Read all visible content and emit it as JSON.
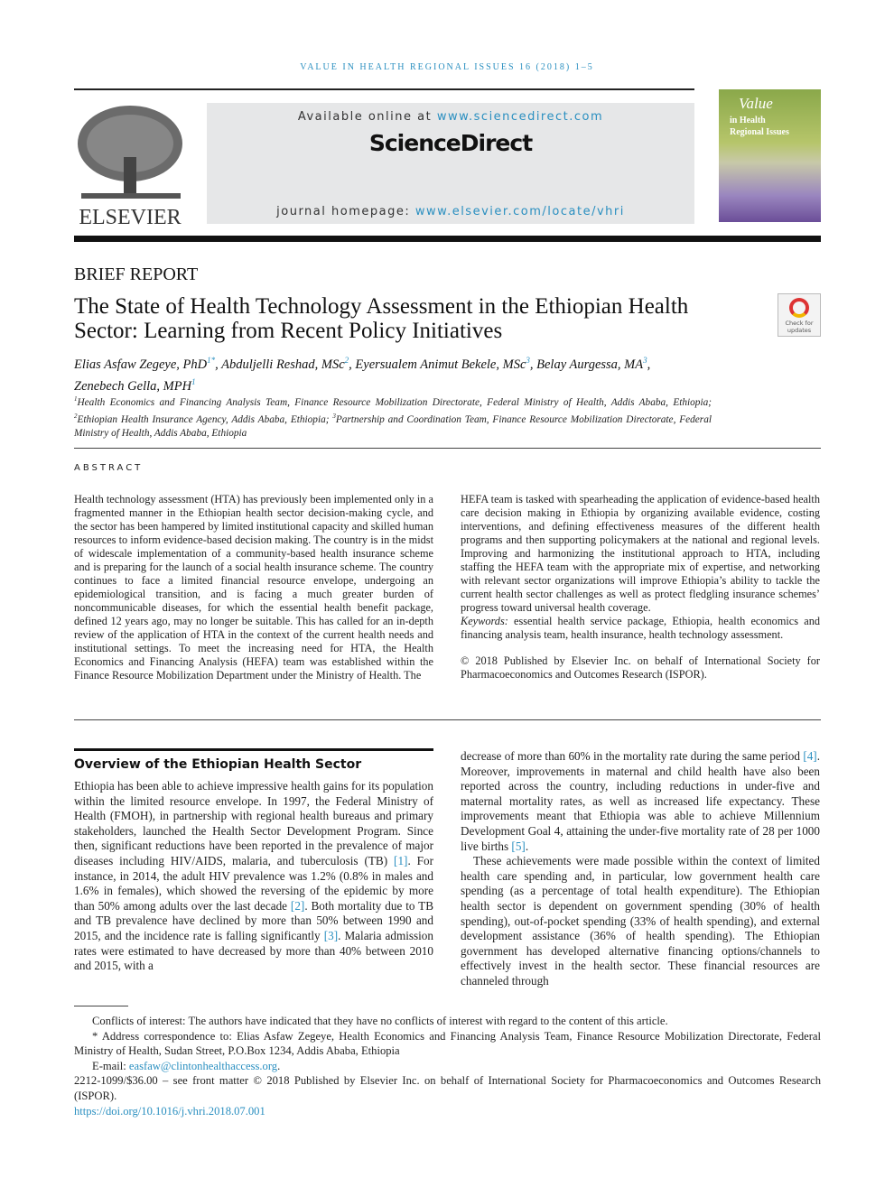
{
  "running_head": "VALUE IN HEALTH REGIONAL ISSUES 16 (2018) 1–5",
  "publisher_logo": "ELSEVIER",
  "banner": {
    "available_prefix": "Available online at ",
    "available_url": "www.sciencedirect.com",
    "brand": "ScienceDirect",
    "homepage_prefix": "journal homepage: ",
    "homepage_url": "www.elsevier.com/locate/vhri"
  },
  "cover": {
    "line1": "Value",
    "line2": "in Health",
    "line3": "Regional Issues"
  },
  "article_type": "BRIEF REPORT",
  "title": "The State of Health Technology Assessment in the Ethiopian Health Sector: Learning from Recent Policy Initiatives",
  "check_updates": "Check for updates",
  "authors": [
    {
      "name": "Elias Asfaw Zegeye, PhD",
      "sup": "1*"
    },
    {
      "name": "Abduljelli Reshad, MSc",
      "sup": "2"
    },
    {
      "name": "Eyersualem Animut Bekele, MSc",
      "sup": "3"
    },
    {
      "name": "Belay Aurgessa, MA",
      "sup": "3"
    },
    {
      "name": "Zenebech Gella, MPH",
      "sup": "1"
    }
  ],
  "affiliations": [
    {
      "sup": "1",
      "text": "Health Economics and Financing Analysis Team, Finance Resource Mobilization Directorate, Federal Ministry of Health, Addis Ababa, Ethiopia; "
    },
    {
      "sup": "2",
      "text": "Ethiopian Health Insurance Agency, Addis Ababa, Ethiopia; "
    },
    {
      "sup": "3",
      "text": "Partnership and Coordination Team, Finance Resource Mobilization Directorate, Federal Ministry of Health, Addis Ababa, Ethiopia"
    }
  ],
  "abstract": {
    "heading": "ABSTRACT",
    "left": "Health technology assessment (HTA) has previously been implemented only in a fragmented manner in the Ethiopian health sector decision-making cycle, and the sector has been hampered by limited institutional capacity and skilled human resources to inform evidence-based decision making. The country is in the midst of widescale implementation of a community-based health insurance scheme and is preparing for the launch of a social health insurance scheme. The country continues to face a limited financial resource envelope, undergoing an epidemiological transition, and is facing a much greater burden of noncommunicable diseases, for which the essential health benefit package, defined 12 years ago, may no longer be suitable. This has called for an in-depth review of the application of HTA in the context of the current health needs and institutional settings. To meet the increasing need for HTA, the Health Economics and Financing Analysis (HEFA) team was established within the Finance Resource Mobilization Department under the Ministry of Health. The",
    "right": "HEFA team is tasked with spearheading the application of evidence-based health care decision making in Ethiopia by organizing available evidence, costing interventions, and defining effectiveness measures of the different health programs and then supporting policymakers at the national and regional levels. Improving and harmonizing the institutional approach to HTA, including staffing the HEFA team with the appropriate mix of expertise, and networking with relevant sector organizations will improve Ethiopia’s ability to tackle the current health sector challenges as well as protect fledgling insurance schemes’ progress toward universal health coverage.",
    "keywords_label": "Keywords:",
    "keywords": " essential health service package, Ethiopia, health economics and financing analysis team, health insurance, health technology assessment.",
    "copyright": "© 2018 Published by Elsevier Inc. on behalf of International Society for Pharmacoeconomics and Outcomes Research (ISPOR)."
  },
  "section": {
    "heading": "Overview of the Ethiopian Health Sector",
    "p1": [
      "Ethiopia has been able to achieve impressive health gains for its population within the limited resource envelope. In 1997, the Federal Ministry of Health (FMOH), in partnership with regional health bureaus and primary stakeholders, launched the Health Sector Development Program. Since then, significant reductions have been reported in the prevalence of major diseases including HIV/AIDS, malaria, and tuberculosis (TB) ",
      "[1]",
      ". For instance, in 2014, the adult HIV prevalence was 1.2% (0.8% in males and 1.6% in females), which showed the reversing of the epidemic by more than 50% among adults over the last decade ",
      "[2]",
      ". Both mortality due to TB and TB prevalence have declined by more than 50% between 1990 and 2015, and the incidence rate is falling significantly ",
      "[3]",
      ". Malaria admission rates were estimated to have decreased by more than 40% between 2010 and 2015, with a decrease of more than 60% in the mortality rate during the same period ",
      "[4]",
      ". Moreover, improvements in maternal and child health have also been reported across the country, including reductions in under-five and maternal mortality rates, as well as increased life expectancy. These improvements meant that Ethiopia was able to achieve Millennium Development Goal 4, attaining the under-five mortality rate of 28 per 1000 live births ",
      "[5]",
      "."
    ],
    "p2": "These achievements were made possible within the context of limited health care spending and, in particular, low government health care spending (as a percentage of total health expenditure). The Ethiopian health sector is dependent on government spending (30% of health spending), out-of-pocket spending (33% of health spending), and external development assistance (36% of health spending). The Ethiopian government has developed alternative financing options/channels to effectively invest in the health sector. These financial resources are channeled through"
  },
  "footnotes": {
    "conflicts": "Conflicts of interest: The authors have indicated that they have no conflicts of interest with regard to the content of this article.",
    "correspondence": "* Address correspondence to: Elias Asfaw Zegeye, Health Economics and Financing Analysis Team, Finance Resource Mobilization Directorate, Federal Ministry of Health, Sudan Street, P.O.Box 1234, Addis Ababa, Ethiopia",
    "email_label": "E-mail: ",
    "email": "easfaw@clintonhealthaccess.org",
    "issn": "2212-1099/$36.00 – see front matter © 2018 Published by Elsevier Inc. on behalf of International Society for Pharmacoeconomics and Outcomes Research (ISPOR).",
    "doi": "https://doi.org/10.1016/j.vhri.2018.07.001"
  },
  "colors": {
    "link": "#2a8fc0",
    "banner_bg": "#e6e7e8"
  }
}
